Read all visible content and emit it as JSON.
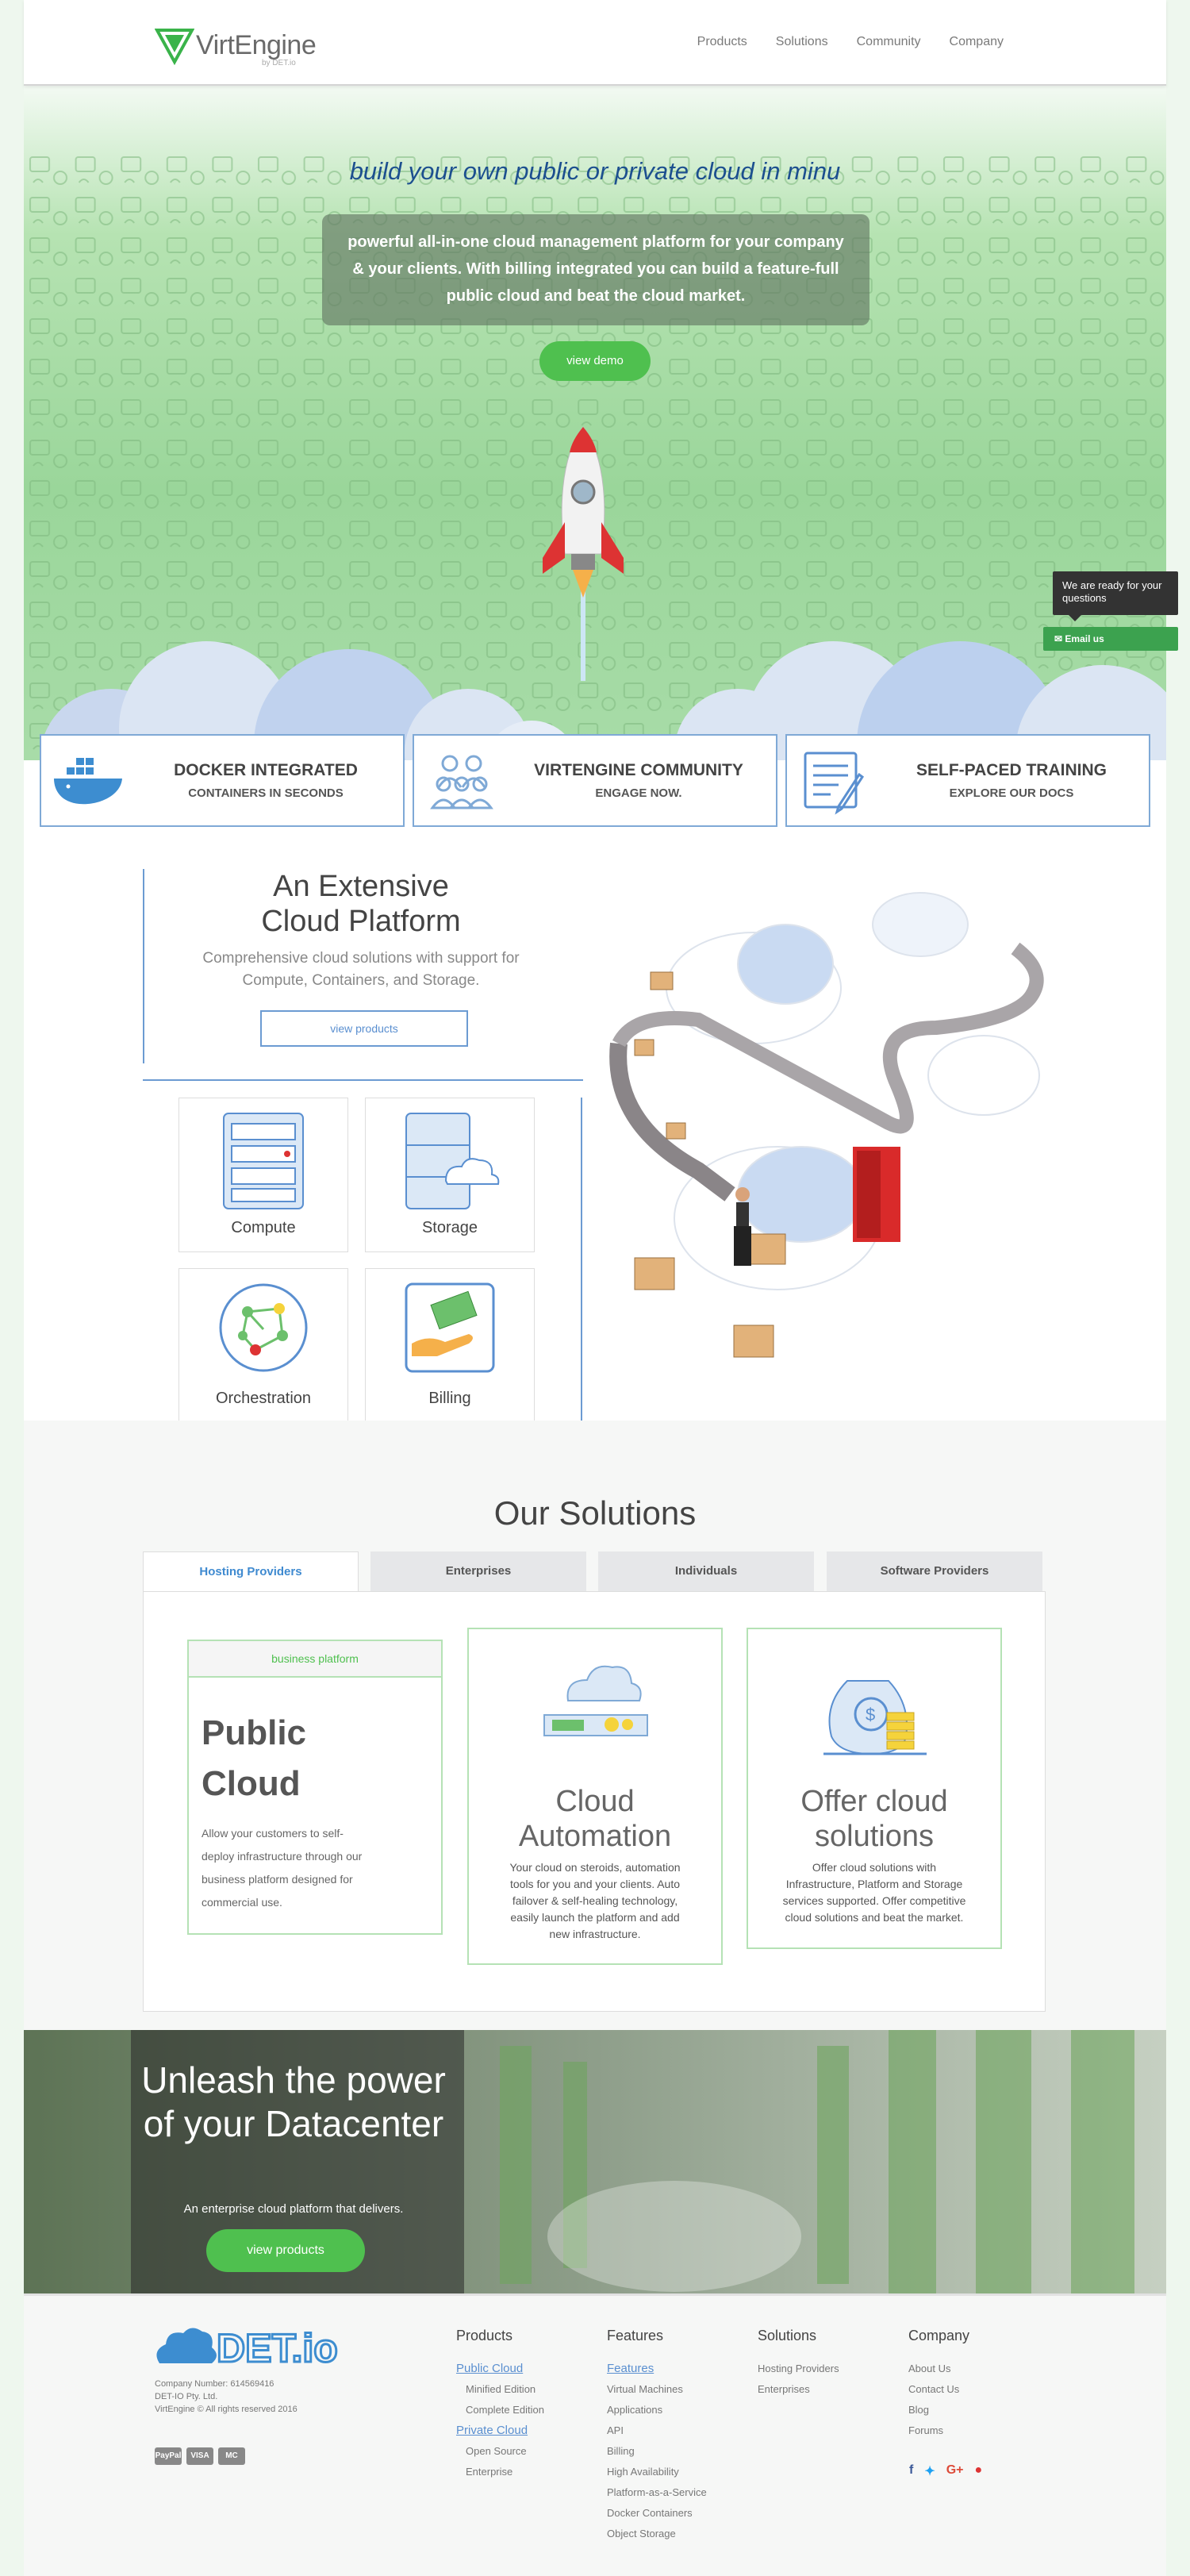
{
  "brand": {
    "name": "VirtEngine",
    "tagline": "by DET.io"
  },
  "nav": [
    "Products",
    "Solutions",
    "Community",
    "Company"
  ],
  "hero": {
    "title": "build your own public or private cloud in minu",
    "text": "powerful all-in-one cloud management platform for your company & your clients. With billing integrated you can build a feature-full public cloud and beat the cloud market.",
    "button": "view demo"
  },
  "chat": {
    "message": "We are ready for your questions",
    "button": "Email us"
  },
  "features": [
    {
      "title": "DOCKER INTEGRATED",
      "subtitle": "CONTAINERS IN SECONDS"
    },
    {
      "title": "VIRTENGINE COMMUNITY",
      "subtitle": "ENGAGE NOW."
    },
    {
      "title": "SELF-PACED TRAINING",
      "subtitle": "EXPLORE OUR DOCS"
    }
  ],
  "platform": {
    "title_line1": "An Extensive",
    "title_line2": "Cloud Platform",
    "subtitle": "Comprehensive cloud solutions with support for Compute, Containers, and Storage.",
    "button": "view products",
    "products": [
      "Compute",
      "Storage",
      "Orchestration",
      "Billing"
    ]
  },
  "solutions": {
    "title": "Our Solutions",
    "tabs": [
      "Hosting Providers",
      "Enterprises",
      "Individuals",
      "Software Providers"
    ],
    "card1": {
      "tag": "business platform",
      "title_line1": "Public",
      "title_line2": "Cloud",
      "body": "Allow your customers to self-deploy infrastructure through our business platform designed for commercial use."
    },
    "card2": {
      "title_line1": "Cloud",
      "title_line2": "Automation",
      "body": "Your cloud on steroids, automation tools for you and your clients. Auto failover & self-healing technology, easily launch the platform and add new infrastructure."
    },
    "card3": {
      "title_line1": "Offer cloud",
      "title_line2": "solutions",
      "body": "Offer cloud solutions with Infrastructure, Platform and Storage services supported. Offer competitive cloud solutions and beat the market."
    }
  },
  "datacenter": {
    "title": "Unleash the power of your Datacenter",
    "subtitle": "An enterprise cloud platform that delivers.",
    "button": "view products"
  },
  "footer": {
    "logo_text": "DET.io",
    "company_lines": [
      "Company Number: 614569416",
      "DET-IO Pty. Ltd.",
      "VirtEngine © All rights reserved 2016"
    ],
    "payments": [
      "PayPal",
      "VISA",
      "MC"
    ],
    "products": {
      "heading": "Products",
      "group1": "Public Cloud",
      "group1_items": [
        "Minified Edition",
        "Complete Edition"
      ],
      "group2": "Private Cloud",
      "group2_items": [
        "Open Source",
        "Enterprise"
      ]
    },
    "features": {
      "heading": "Features",
      "group": "Features",
      "items": [
        "Virtual Machines",
        "Applications",
        "API",
        "Billing",
        "High Availability",
        "Platform-as-a-Service",
        "Docker Containers",
        "Object Storage"
      ]
    },
    "solutions": {
      "heading": "Solutions",
      "items": [
        "Hosting Providers",
        "Enterprises"
      ]
    },
    "company": {
      "heading": "Company",
      "items": [
        "About Us",
        "Contact Us",
        "Blog",
        "Forums"
      ]
    },
    "social": [
      "f",
      "t",
      "G+",
      "gh"
    ]
  }
}
